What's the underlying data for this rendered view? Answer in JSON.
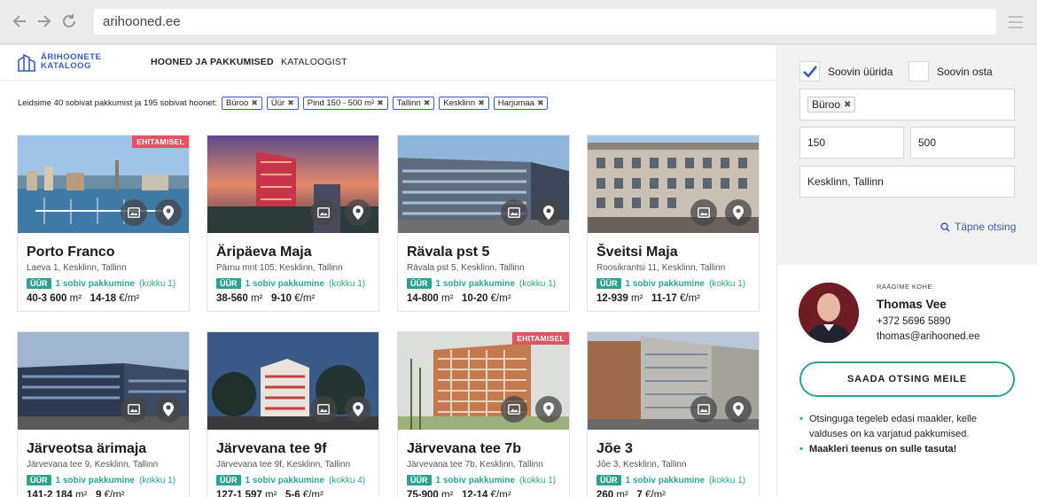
{
  "browser": {
    "url": "arihooned.ee",
    "back_icon": "arrow-left-icon",
    "forward_icon": "arrow-right-icon",
    "reload_icon": "reload-icon",
    "menu_icon": "hamburger-icon"
  },
  "site": {
    "logo_line1": "ÄRIHOONETE",
    "logo_line2": "KATALOOG",
    "nav": [
      {
        "label": "HOONED JA PAKKUMISED",
        "active": true
      },
      {
        "label": "KATALOOGIST",
        "active": false
      }
    ]
  },
  "results": {
    "summary": "Leidsime 40 sobivat pakkumist ja 195 sobivat hoonet:",
    "filters": [
      "Büroo",
      "Üür",
      "Pind 150 - 500 m²",
      "Tallinn",
      "Kesklinn",
      "Harjumaa"
    ]
  },
  "cards": [
    {
      "title": "Porto Franco",
      "address": "Laeva 1, Kesklinn, Tallinn",
      "badge": "EHITAMISEL",
      "offer_type": "ÜÜR",
      "offer_link": "1 sobiv pakkumine",
      "offer_total": "(kokku 1)",
      "area": "40-3 600",
      "price": "14-18",
      "scene": "harbor"
    },
    {
      "title": "Äripäeva Maja",
      "address": "Pärnu mnt 105, Kesklinn, Tallinn",
      "badge": "",
      "offer_type": "ÜÜR",
      "offer_link": "1 sobiv pakkumine",
      "offer_total": "(kokku 1)",
      "area": "38-560",
      "price": "9-10",
      "scene": "sunset"
    },
    {
      "title": "Rävala pst 5",
      "address": "Rävala pst 5, Kesklinn, Tallinn",
      "badge": "",
      "offer_type": "ÜÜR",
      "offer_link": "1 sobiv pakkumine",
      "offer_total": "(kokku 1)",
      "area": "14-800",
      "price": "10-20",
      "scene": "office"
    },
    {
      "title": "Šveitsi Maja",
      "address": "Roosikrantsi 11, Kesklinn, Tallinn",
      "badge": "",
      "offer_type": "ÜÜR",
      "offer_link": "1 sobiv pakkumine",
      "offer_total": "(kokku 1)",
      "area": "12-939",
      "price": "11-17",
      "scene": "classic"
    },
    {
      "title": "Järveotsa ärimaja",
      "address": "Järvevana tee 9, Kesklinn, Tallinn",
      "badge": "",
      "offer_type": "ÜÜR",
      "offer_link": "1 sobiv pakkumine",
      "offer_total": "(kokku 1)",
      "area": "141-2 184",
      "price": "9",
      "scene": "dusk"
    },
    {
      "title": "Järvevana tee 9f",
      "address": "Järvevana tee 9f, Kesklinn, Tallinn",
      "badge": "",
      "offer_type": "ÜÜR",
      "offer_link": "1 sobiv pakkumine",
      "offer_total": "(kokku 4)",
      "area": "127-1 597",
      "price": "5-6",
      "scene": "night"
    },
    {
      "title": "Järvevana tee 7b",
      "address": "Järvevana tee 7b, Kesklinn, Tallinn",
      "badge": "EHITAMISEL",
      "offer_type": "ÜÜR",
      "offer_link": "1 sobiv pakkumine",
      "offer_total": "(kokku 1)",
      "area": "75-900",
      "price": "12-14",
      "scene": "render"
    },
    {
      "title": "Jõe 3",
      "address": "Jõe 3, Kesklinn, Tallinn",
      "badge": "",
      "offer_type": "ÜÜR",
      "offer_link": "1 sobiv pakkumine",
      "offer_total": "(kokku 1)",
      "area": "260",
      "price": "7",
      "scene": "street"
    }
  ],
  "units": {
    "area": "m²",
    "price": "€/m²"
  },
  "sidebar": {
    "rent_label": "Soovin üürida",
    "rent_checked": true,
    "buy_label": "Soovin osta",
    "buy_checked": false,
    "type_chip": "Büroo",
    "area_min": "150",
    "area_max": "500",
    "location": "Kesklinn, Tallinn",
    "advanced_search": "Täpne otsing",
    "contact_label": "RÄÄGIME KOHE:",
    "contact_name": "Thomas Vee",
    "contact_phone": "+372 5696 5890",
    "contact_email": "thomas@arihooned.ee",
    "send_button": "SAADA OTSING MEILE",
    "note1": "Otsinguga tegeleb edasi maakler, kelle valduses on ka varjatud pakkumised.",
    "note2": "Maakleri teenus on sulle tasuta!"
  },
  "colors": {
    "brand_blue": "#3a5bc4",
    "teal": "#2ca392",
    "badge_red": "#e05561"
  }
}
